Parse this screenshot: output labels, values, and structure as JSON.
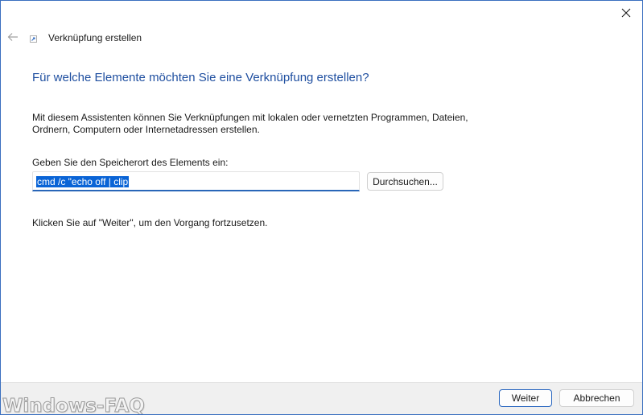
{
  "window": {
    "title": "Verknüpfung erstellen",
    "close_icon": "close-icon",
    "back_icon": "back-arrow-icon",
    "app_icon": "shortcut-icon"
  },
  "wizard": {
    "heading": "Für welche Elemente möchten Sie eine Verknüpfung erstellen?",
    "description_line1": "Mit diesem Assistenten können Sie Verknüpfungen mit lokalen oder vernetzten Programmen, Dateien,",
    "description_line2": "Ordnern, Computern oder Internetadressen erstellen.",
    "location_label": "Geben Sie den Speicherort des Elements ein:",
    "location_value": "cmd /c \"echo off | clip",
    "browse_label": "Durchsuchen...",
    "continue_hint": "Klicken Sie auf \"Weiter\", um den Vorgang fortzusetzen."
  },
  "footer": {
    "next_label": "Weiter",
    "cancel_label": "Abbrechen"
  },
  "watermark": "Windows-FAQ",
  "colors": {
    "accent": "#2966b8",
    "heading": "#1f4fa0",
    "selection": "#0a64d6",
    "footer_bg": "#f0f0f0"
  }
}
